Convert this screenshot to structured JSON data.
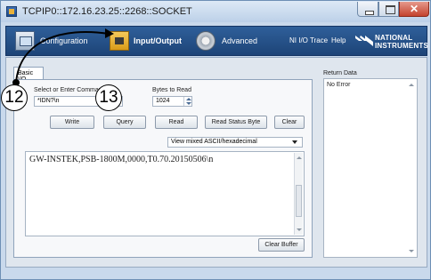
{
  "window": {
    "title": "TCPIP0::172.16.23.25::2268::SOCKET",
    "close_glyph": "✕"
  },
  "toolbar": {
    "configuration_label": "Configuration",
    "io_label": "Input/Output",
    "advanced_label": "Advanced",
    "trace_label": "NI I/O Trace",
    "help_label": "Help",
    "logo_line1": "NATIONAL",
    "logo_line2": "INSTRUMENTS"
  },
  "tabs": {
    "basic_io": "Basic I/O"
  },
  "basic_io": {
    "command_label": "Select or Enter Command",
    "command_value": "*IDN?\\n",
    "bytes_label": "Bytes to Read",
    "bytes_value": "1024",
    "write_button": "Write",
    "query_button": "Query",
    "read_button": "Read",
    "read_status_button": "Read Status Byte",
    "clear_button": "Clear",
    "view_mode": "View mixed ASCII/hexadecimal",
    "response_text": "GW-INSTEK,PSB-1800M,0000,T0.70.20150506\\n",
    "clear_buffer_button": "Clear Buffer"
  },
  "return_data": {
    "label": "Return Data",
    "value": "No Error"
  },
  "callouts": {
    "step_a": "12",
    "step_b": "13"
  },
  "colors": {
    "toolbar_bg": "#2f5f9a",
    "window_frame": "#c9d9ec",
    "callout_border": "#000000"
  },
  "icons": {
    "configuration": "configuration-icon",
    "io": "input-output-icon",
    "advanced": "gear-icon",
    "logo": "ni-eagle-logo"
  }
}
